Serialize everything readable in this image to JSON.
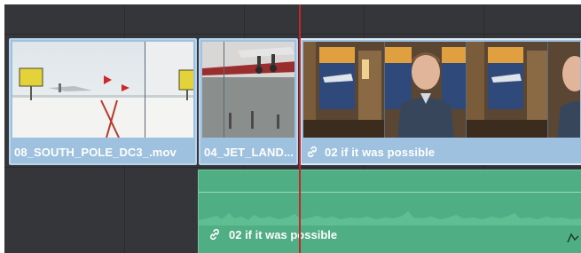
{
  "timeline": {
    "clips": [
      {
        "label": "08_SOUTH_POLE_DC3_.mov",
        "icon": ""
      },
      {
        "label": "04_JET_LAND...",
        "icon": ""
      },
      {
        "label": "02 if it was possible",
        "icon": "link-icon"
      }
    ],
    "audio_clip": {
      "label": "02 if it was possible",
      "icon": "link-icon"
    },
    "colors": {
      "timeline_bg": "#35363a",
      "video_clip": "#9dc1df",
      "audio_clip": "#4fae84",
      "playhead": "#c2272d"
    }
  }
}
